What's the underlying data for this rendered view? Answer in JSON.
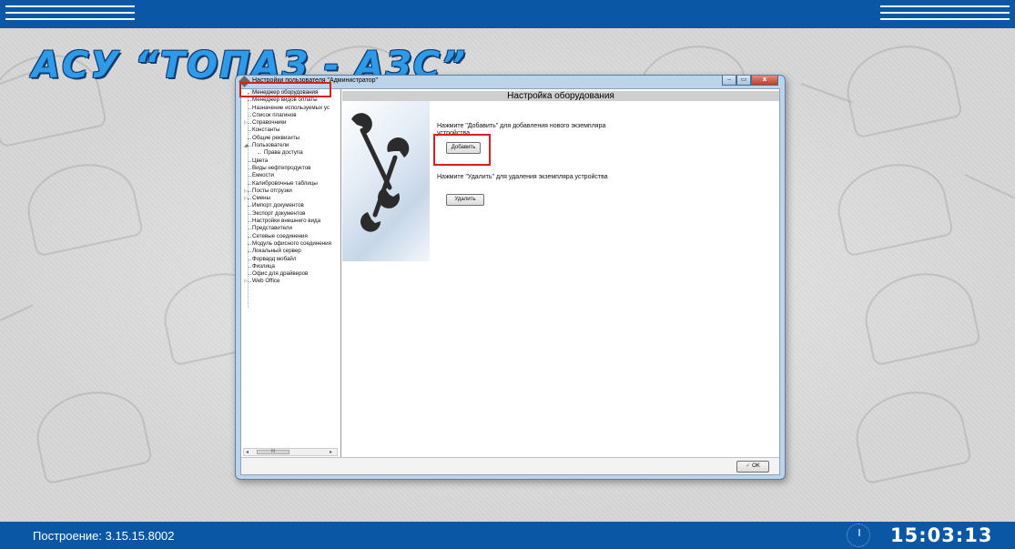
{
  "app": {
    "brand": "АСУ “ТОПАЗ - АЗС”"
  },
  "window": {
    "title": "Настройки пользователя \"Администратор\"",
    "buttons": {
      "minimize": "‒",
      "maximize": "▭",
      "close": "x"
    }
  },
  "tree": {
    "items": [
      {
        "label": "Менеджер оборудования",
        "selected": true
      },
      {
        "label": "Менеджер видов оплаты"
      },
      {
        "label": "Назначение используемых ус"
      },
      {
        "label": "Список плагинов"
      },
      {
        "label": "Справочники",
        "expander": "▷"
      },
      {
        "label": "Константы"
      },
      {
        "label": "Общие реквизиты"
      },
      {
        "label": "Пользователи",
        "expander": "◢"
      },
      {
        "label": "Права доступа",
        "indent": true
      },
      {
        "label": "Цвета"
      },
      {
        "label": "Виды нефтепродуктов"
      },
      {
        "label": "Емкости"
      },
      {
        "label": "Калибровочные таблицы"
      },
      {
        "label": "Посты отгрузки",
        "expander": "▷"
      },
      {
        "label": "Смены",
        "expander": "▷"
      },
      {
        "label": "Импорт документов"
      },
      {
        "label": "Экспорт документов"
      },
      {
        "label": "Настройки внешнего вида"
      },
      {
        "label": "Представители"
      },
      {
        "label": "Сетевые соединения"
      },
      {
        "label": "Модуль офисного соединения"
      },
      {
        "label": "Локальный сервер"
      },
      {
        "label": "Форвард мобайл"
      },
      {
        "label": "Физлица"
      },
      {
        "label": "Офис для драйверов"
      },
      {
        "label": "Web Office",
        "expander": "▷"
      }
    ],
    "scroll": {
      "left": "◂",
      "right": "▸",
      "thumb": "III"
    }
  },
  "content": {
    "header": "Настройка оборудования",
    "add_hint": "Нажмите \"Добавить\" для добавления нового экземпляра устройства",
    "add_button": "Добавить",
    "delete_hint": "Нажмите \"Удалить\" для удаления экземпляра устройства",
    "delete_button": "Удалить"
  },
  "footer": {
    "ok_button": "OK",
    "ok_icon": "check-icon"
  },
  "status": {
    "build_label": "Построение: 3.15.15.8002",
    "time": "15:03:13"
  },
  "colors": {
    "bar": "#0a57a5",
    "highlight": "#d6221f",
    "brand": "#2f9be8"
  }
}
